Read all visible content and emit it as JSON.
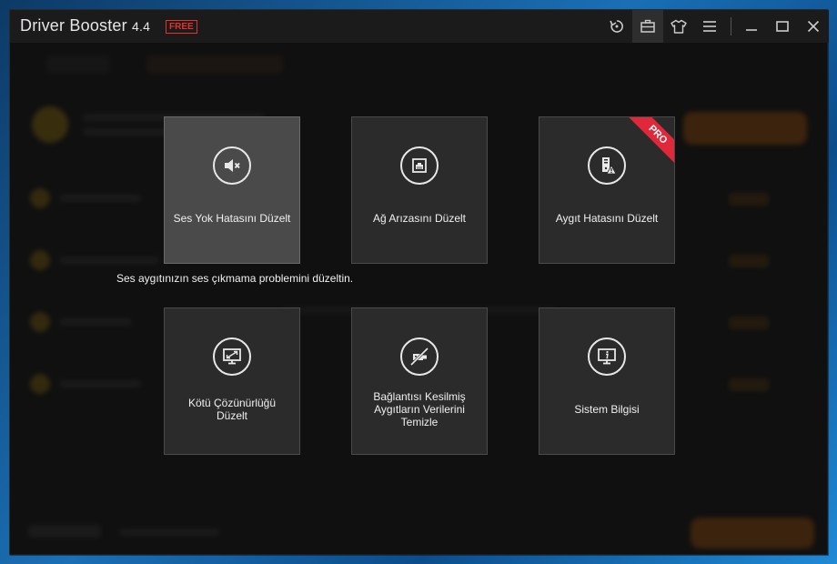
{
  "window": {
    "title": "Driver Booster",
    "version": "4.4",
    "edition_badge": "FREE"
  },
  "toolbar": {
    "icons": [
      "restore-icon",
      "toolbox-icon",
      "skin-icon",
      "menu-icon",
      "minimize-icon",
      "maximize-icon",
      "close-icon"
    ]
  },
  "tools": [
    {
      "id": "no-sound",
      "label": "Ses Yok Hatasını Düzelt",
      "icon": "muted-speaker-icon",
      "pro": false,
      "highlighted": true
    },
    {
      "id": "network",
      "label": "Ağ Arızasını Düzelt",
      "icon": "network-icon",
      "pro": false,
      "highlighted": false
    },
    {
      "id": "device-error",
      "label": "Aygıt Hatasını Düzelt",
      "icon": "device-warning-icon",
      "pro": true,
      "highlighted": false
    },
    {
      "id": "bad-resolution",
      "label": "Kötü Çözünürlüğü Düzelt",
      "icon": "monitor-resize-icon",
      "pro": false,
      "highlighted": false
    },
    {
      "id": "disconnected-devices",
      "label": "Bağlantısı Kesilmiş Aygıtların Verilerini Temizle",
      "icon": "unplugged-usb-icon",
      "pro": false,
      "highlighted": false
    },
    {
      "id": "system-info",
      "label": "Sistem Bilgisi",
      "icon": "info-monitor-icon",
      "pro": false,
      "highlighted": false
    }
  ],
  "pro_badge": "PRO",
  "hover_description": "Ses aygıtınızın ses çıkmama problemini düzeltin.",
  "colors": {
    "accent_orange": "#e08a1e",
    "badge_red": "#e2332b",
    "tile_bg": "#2b2b2b",
    "tile_highlight": "#4a4a4a"
  }
}
